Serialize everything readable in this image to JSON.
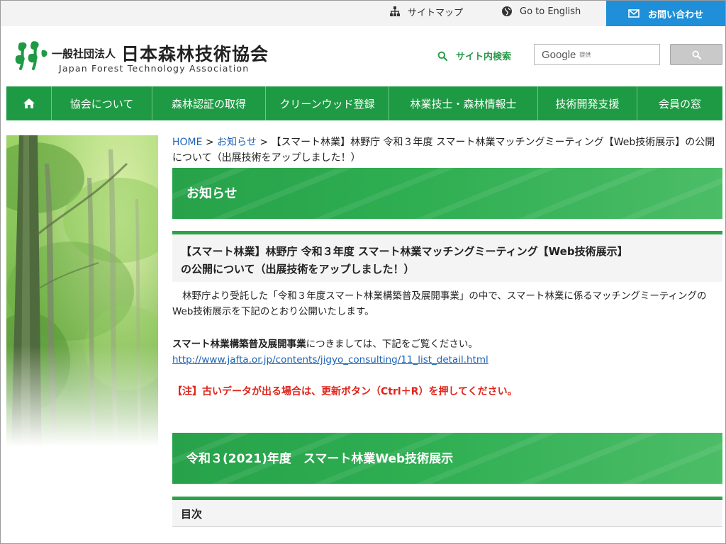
{
  "utility": {
    "sitemap": "サイトマップ",
    "english": "Go to English",
    "contact": "お問い合わせ"
  },
  "logo": {
    "prefix": "一般社団法人",
    "name": "日本森林技術協会",
    "english": "Japan Forest Technology Association"
  },
  "search": {
    "label": "サイト内検索",
    "brand": "Google",
    "provided": "提供"
  },
  "nav": {
    "home_icon": "home-icon",
    "items": [
      {
        "label": "協会について"
      },
      {
        "label": "森林認証の取得"
      },
      {
        "label": "クリーンウッド登録"
      },
      {
        "label": "林業技士・森林情報士"
      },
      {
        "label": "技術開発支援"
      },
      {
        "label": "会員の窓"
      }
    ]
  },
  "breadcrumb": {
    "home": "HOME",
    "sep": ">",
    "news": "お知らせ",
    "current": "【スマート林業】林野庁 令和３年度 スマート林業マッチングミーティング【Web技術展示】の公開について（出展技術をアップしました！）"
  },
  "section_band": "お知らせ",
  "article": {
    "title_line1": "【スマート林業】林野庁 令和３年度 スマート林業マッチングミーティング【Web技術展示】",
    "title_line2": "の公開について（出展技術をアップしました！）",
    "para1": "林野庁より受託した「令和３年度スマート林業構築普及展開事業」の中で、スマート林業に係るマッチングミーティングのWeb技術展示を下記のとおり公開いたします。",
    "para2_bold": "スマート林業構築普及展開事業",
    "para2_rest": "につきましては、下記をご覧ください。",
    "link": "http://www.jafta.or.jp/contents/jigyo_consulting/11_list_detail.html",
    "note": "【注】古いデータが出る場合は、更新ボタン（Ctrl＋R）を押してください。"
  },
  "exhibit_band": "令和３(2021)年度　スマート林業Web技術展示",
  "toc": "目次",
  "colors": {
    "brand_green": "#1f9a44",
    "contact_blue": "#1e8fd8",
    "link_blue": "#1d63b5",
    "note_red": "#e0241b"
  }
}
